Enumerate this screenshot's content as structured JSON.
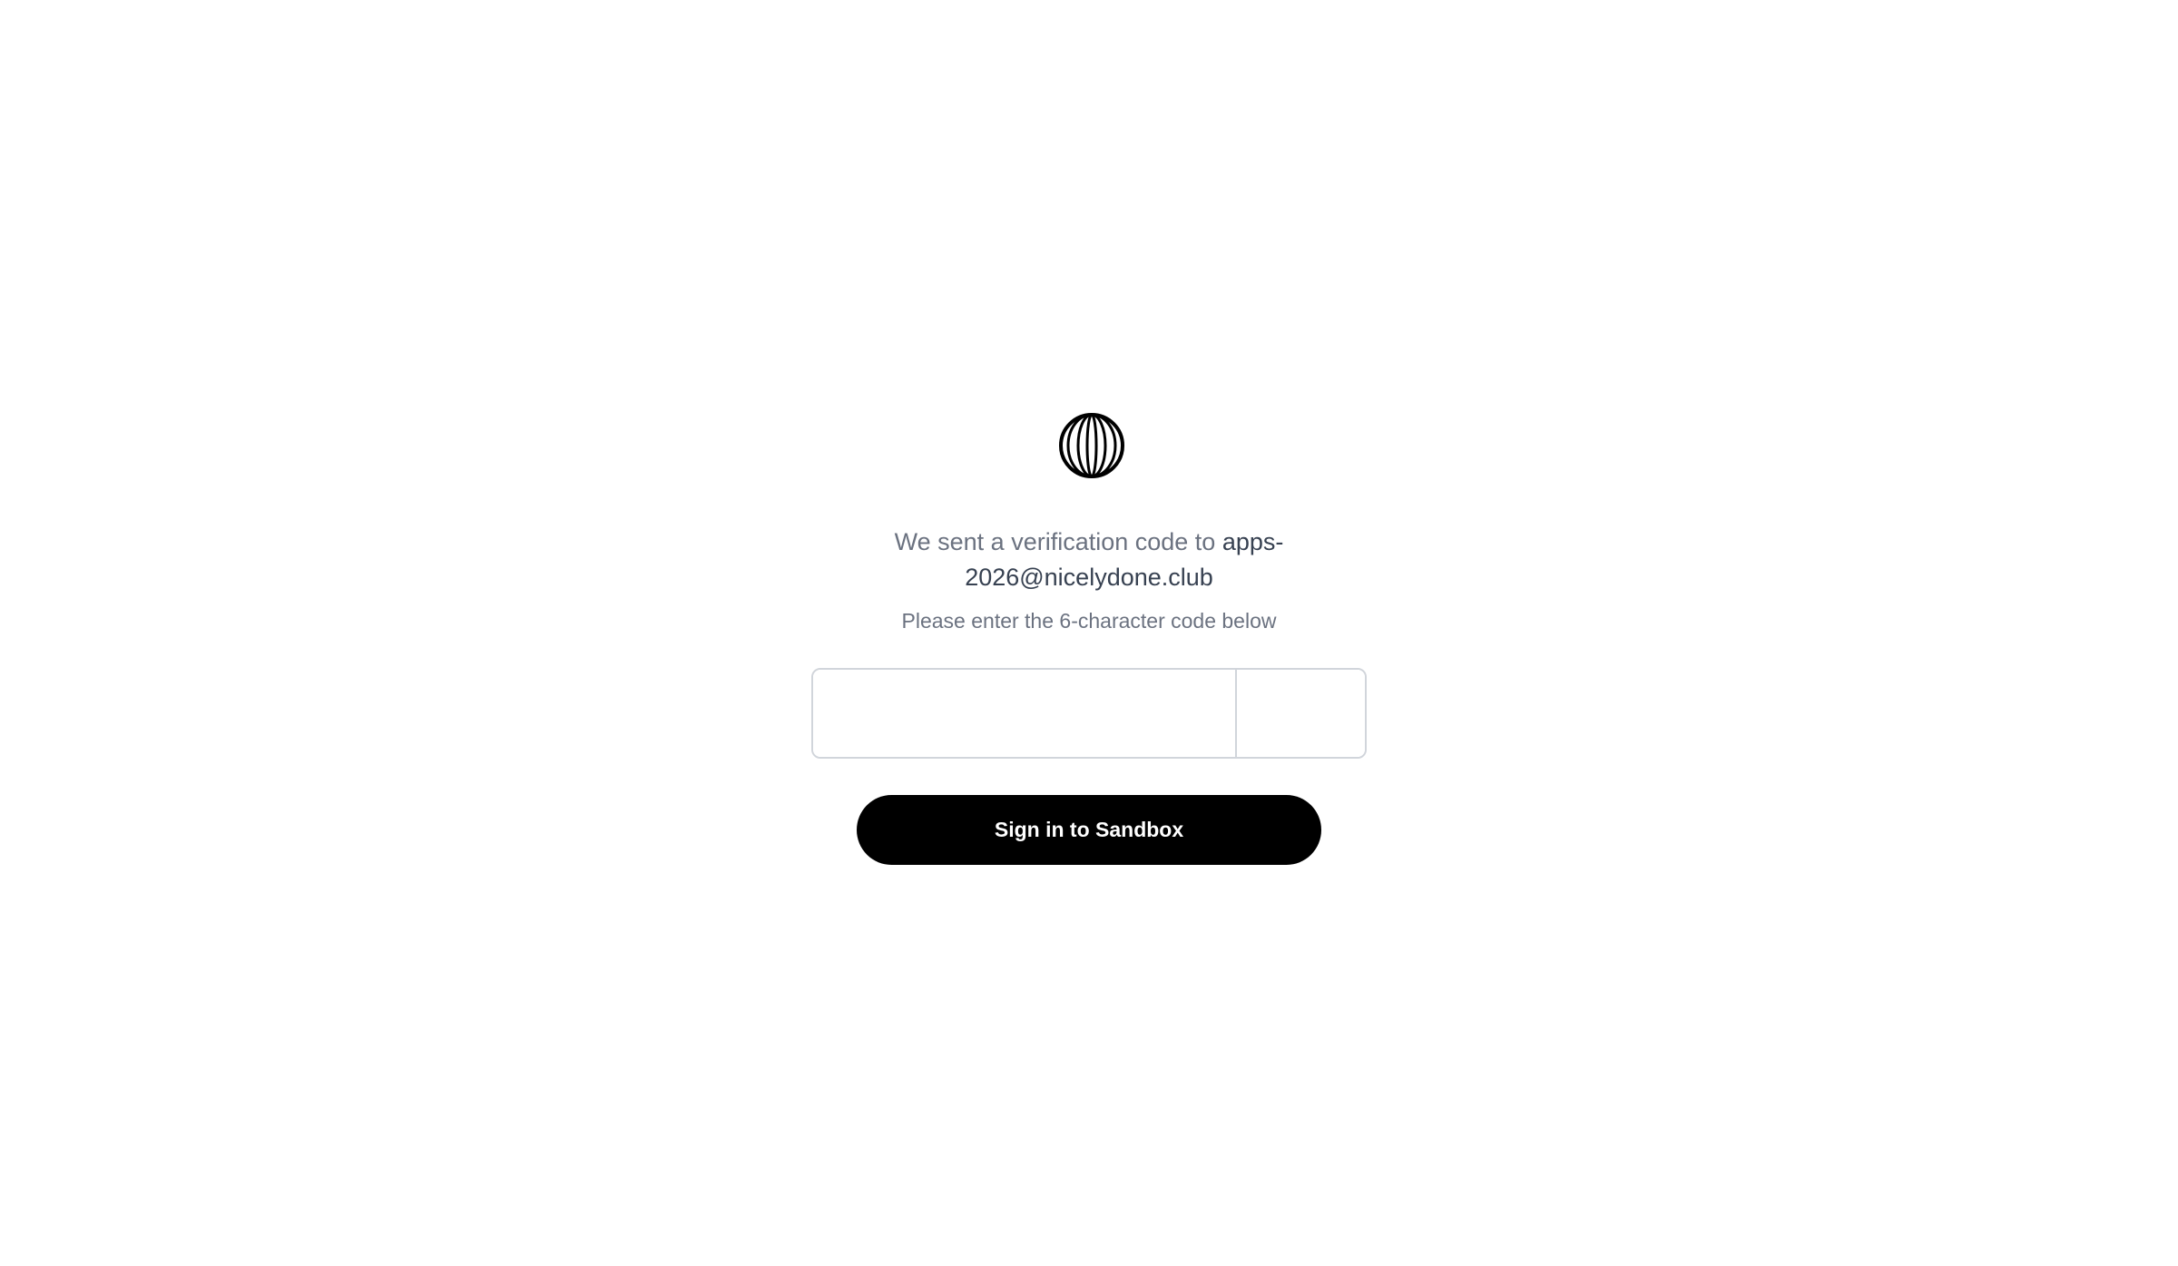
{
  "logo": {
    "icon": "globe-lines-icon"
  },
  "verification": {
    "message_prefix": "We sent a verification code to ",
    "email": "apps-2026@nicelydone.club",
    "instruction": "Please enter the 6-character code below"
  },
  "code_inputs": [
    {
      "value": ""
    },
    {
      "value": ""
    },
    {
      "value": ""
    },
    {
      "value": ""
    },
    {
      "value": ""
    },
    {
      "value": ""
    }
  ],
  "submit_button": {
    "label": "Sign in to Sandbox"
  },
  "colors": {
    "primary_text": "#374151",
    "secondary_text": "#6b7280",
    "border": "#d1d5db",
    "button_bg": "#000000",
    "button_text": "#ffffff"
  }
}
